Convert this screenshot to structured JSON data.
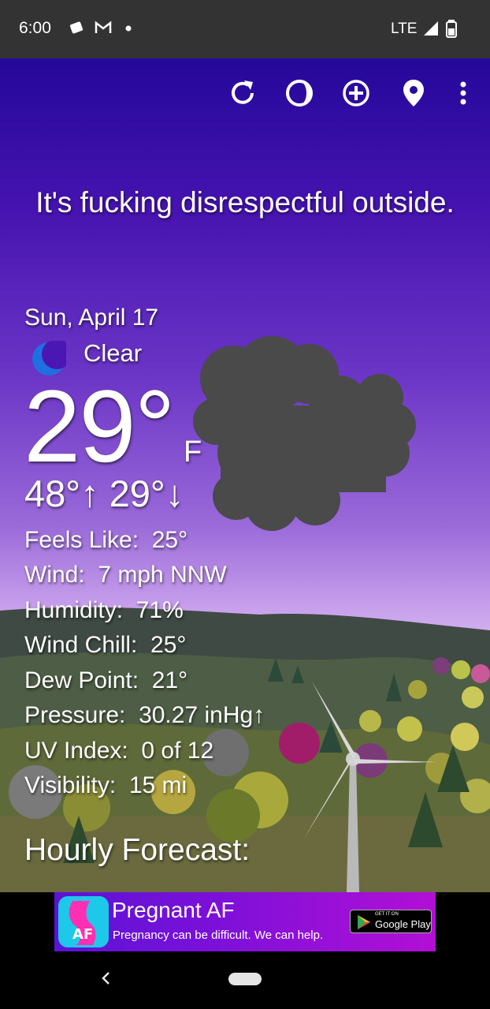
{
  "status_bar": {
    "time": "6:00",
    "network": "LTE",
    "icons": [
      "notification-icon",
      "gmail-icon",
      "dot-icon",
      "signal-icon",
      "battery-icon"
    ]
  },
  "toolbar": {
    "icons": [
      "refresh-icon",
      "theme-icon",
      "add-location-icon",
      "location-pin-icon",
      "more-vert-icon"
    ]
  },
  "headline": "It's fucking disrespectful outside.",
  "current": {
    "date": "Sun, April 17",
    "condition": "Clear",
    "condition_icon": "moon-icon",
    "temperature": "29°",
    "unit": "F",
    "high_low": "48°↑ 29°↓"
  },
  "details": [
    {
      "label": "Feels Like:",
      "value": "25°"
    },
    {
      "label": "Wind:",
      "value": "7 mph NNW"
    },
    {
      "label": "Humidity:",
      "value": "71%"
    },
    {
      "label": "Wind Chill:",
      "value": "25°"
    },
    {
      "label": "Dew Point:",
      "value": "21°"
    },
    {
      "label": "Pressure:",
      "value": "30.27 inHg↑"
    },
    {
      "label": "UV Index:",
      "value": "0 of 12"
    },
    {
      "label": "Visibility:",
      "value": "15 mi"
    }
  ],
  "hourly_heading": "Hourly Forecast:",
  "ad": {
    "title": "Pregnant AF",
    "subtitle": "Pregnancy can be difficult. We can help.",
    "store_small": "GET IT ON",
    "store_label": "Google Play"
  },
  "colors": {
    "status_bar": "#333333",
    "sky_top": "#24089a",
    "sky_bottom": "#d3b5ef",
    "cloud": "#4a4a4a",
    "moon": "#1f6fe0"
  }
}
